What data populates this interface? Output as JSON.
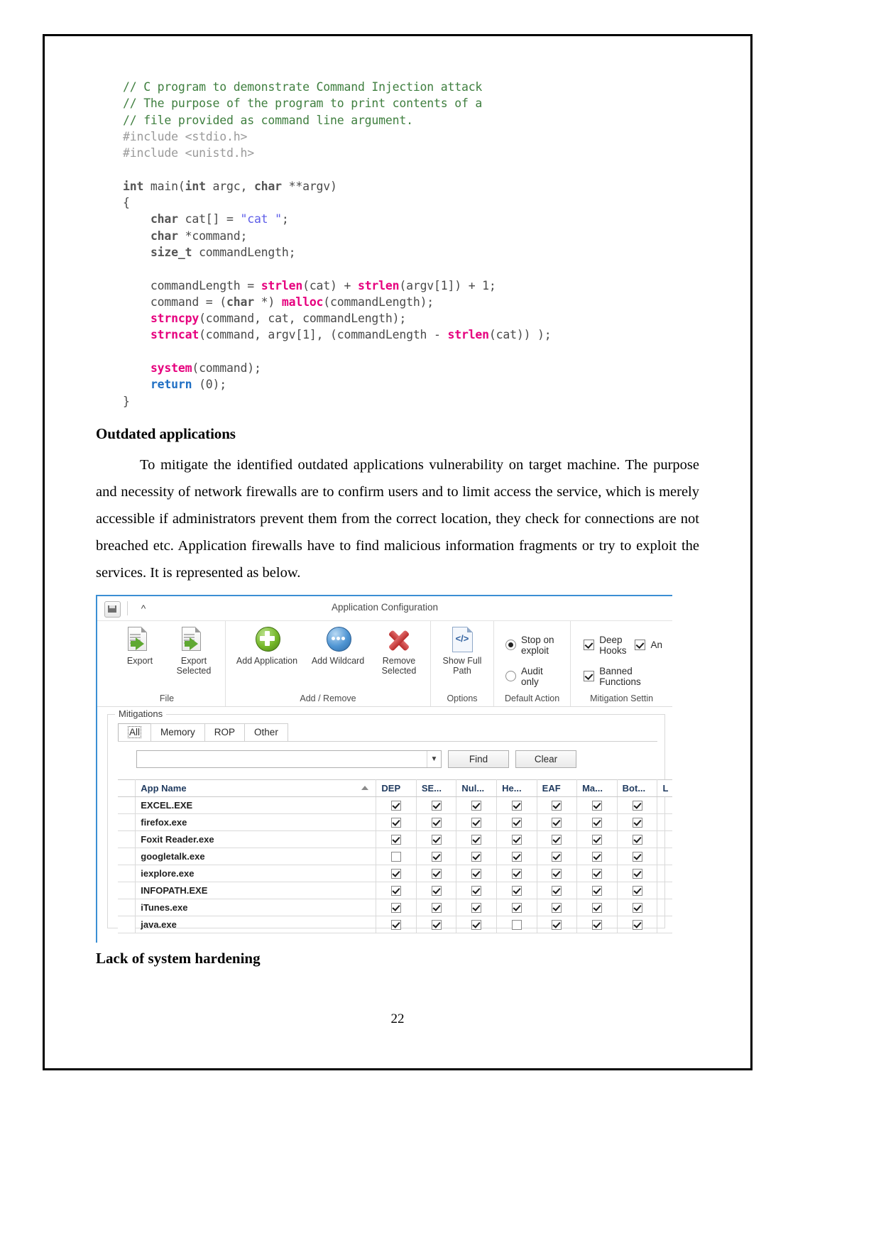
{
  "document": {
    "page_number": "22",
    "code": {
      "language": "c",
      "lines": [
        [
          {
            "t": "// C program to demonstrate Command Injection attack",
            "c": "comment"
          }
        ],
        [
          {
            "t": "// The purpose of the program to print contents of a",
            "c": "comment"
          }
        ],
        [
          {
            "t": "// file provided as command line argument.",
            "c": "comment"
          }
        ],
        [
          {
            "t": "#include <stdio.h>",
            "c": "pre"
          }
        ],
        [
          {
            "t": "#include <unistd.h>",
            "c": "pre"
          }
        ],
        [
          {
            "t": "",
            "c": "plain"
          }
        ],
        [
          {
            "t": "int",
            "c": "kw"
          },
          {
            "t": " main(",
            "c": "plain"
          },
          {
            "t": "int",
            "c": "kw"
          },
          {
            "t": " argc, ",
            "c": "plain"
          },
          {
            "t": "char",
            "c": "kw"
          },
          {
            "t": " **argv)",
            "c": "plain"
          }
        ],
        [
          {
            "t": "{",
            "c": "plain"
          }
        ],
        [
          {
            "t": "    ",
            "c": "plain"
          },
          {
            "t": "char",
            "c": "kw"
          },
          {
            "t": " cat[] = ",
            "c": "plain"
          },
          {
            "t": "\"cat \"",
            "c": "str"
          },
          {
            "t": ";",
            "c": "plain"
          }
        ],
        [
          {
            "t": "    ",
            "c": "plain"
          },
          {
            "t": "char",
            "c": "kw"
          },
          {
            "t": " *command;",
            "c": "plain"
          }
        ],
        [
          {
            "t": "    ",
            "c": "plain"
          },
          {
            "t": "size_t",
            "c": "kw"
          },
          {
            "t": " commandLength;",
            "c": "plain"
          }
        ],
        [
          {
            "t": "",
            "c": "plain"
          }
        ],
        [
          {
            "t": "    commandLength = ",
            "c": "plain"
          },
          {
            "t": "strlen",
            "c": "pink"
          },
          {
            "t": "(cat) + ",
            "c": "plain"
          },
          {
            "t": "strlen",
            "c": "pink"
          },
          {
            "t": "(argv[1]) + 1;",
            "c": "plain"
          }
        ],
        [
          {
            "t": "    command = (",
            "c": "plain"
          },
          {
            "t": "char",
            "c": "kw"
          },
          {
            "t": " *) ",
            "c": "plain"
          },
          {
            "t": "malloc",
            "c": "pink"
          },
          {
            "t": "(commandLength);",
            "c": "plain"
          }
        ],
        [
          {
            "t": "    ",
            "c": "plain"
          },
          {
            "t": "strncpy",
            "c": "pink"
          },
          {
            "t": "(command, cat, commandLength);",
            "c": "plain"
          }
        ],
        [
          {
            "t": "    ",
            "c": "plain"
          },
          {
            "t": "strncat",
            "c": "pink"
          },
          {
            "t": "(command, argv[1], (commandLength - ",
            "c": "plain"
          },
          {
            "t": "strlen",
            "c": "pink"
          },
          {
            "t": "(cat)) );",
            "c": "plain"
          }
        ],
        [
          {
            "t": "",
            "c": "plain"
          }
        ],
        [
          {
            "t": "    ",
            "c": "plain"
          },
          {
            "t": "system",
            "c": "pink"
          },
          {
            "t": "(command);",
            "c": "plain"
          }
        ],
        [
          {
            "t": "    ",
            "c": "plain"
          },
          {
            "t": "return",
            "c": "blue"
          },
          {
            "t": " (0);",
            "c": "plain"
          }
        ],
        [
          {
            "t": "}",
            "c": "plain"
          }
        ]
      ]
    },
    "heading_outdated": "Outdated applications",
    "paragraph": "To mitigate the identified outdated applications vulnerability on target machine. The purpose and necessity of network firewalls are to confirm users and to limit access the service, which is merely accessible if administrators prevent them from the correct location, they check for connections are not breached etc.  Application firewalls have to find malicious information fragments or try to exploit the services.  It is represented as below.",
    "heading_hardening": "Lack of system hardening"
  },
  "emet": {
    "title": "Application Configuration",
    "quick_access": {
      "save_icon": "save-icon",
      "chevron_icon": "chevron-up-icon"
    },
    "ribbon": {
      "groups": [
        {
          "label": "File",
          "buttons": [
            {
              "label": "Export",
              "icon": "export-page-icon"
            },
            {
              "label": "Export\nSelected",
              "icon": "export-selected-page-icon"
            }
          ]
        },
        {
          "label": "Add / Remove",
          "buttons": [
            {
              "label": "Add Application",
              "icon": "green-plus-circle-icon"
            },
            {
              "label": "Add Wildcard",
              "icon": "blue-ellipsis-circle-icon"
            },
            {
              "label": "Remove\nSelected",
              "icon": "red-x-icon"
            }
          ]
        },
        {
          "label": "Options",
          "buttons": [
            {
              "label": "Show Full\nPath",
              "icon": "code-page-icon"
            }
          ]
        },
        {
          "label": "Default Action",
          "radios": [
            {
              "label": "Stop on exploit",
              "checked": true,
              "accesskey": "S"
            },
            {
              "label": "Audit only",
              "checked": false,
              "accesskey": "u"
            }
          ]
        },
        {
          "label": "Mitigation Settin",
          "checkboxes": [
            {
              "label": "Deep Hooks",
              "checked": true,
              "accesskey": "H"
            },
            {
              "label": "An",
              "checked": true,
              "accesskey": ""
            },
            {
              "label": "Banned Functions",
              "checked": true,
              "accesskey": "B"
            }
          ]
        }
      ]
    },
    "mitigations": {
      "legend": "Mitigations",
      "tabs": [
        {
          "label": "All",
          "active": true
        },
        {
          "label": "Memory",
          "active": false
        },
        {
          "label": "ROP",
          "active": false
        },
        {
          "label": "Other",
          "active": false
        }
      ],
      "search": {
        "value": "",
        "placeholder": "",
        "dropdown_icon": "chevron-down-icon",
        "find_button": "Find",
        "clear_button": "Clear"
      },
      "table": {
        "columns": [
          "",
          "App Name",
          "DEP",
          "SE...",
          "Nul...",
          "He...",
          "EAF",
          "Ma...",
          "Bot...",
          "L"
        ],
        "sorted_by": "App Name",
        "sort_direction": "asc",
        "rows": [
          {
            "name": "EXCEL.EXE",
            "checks": [
              true,
              true,
              true,
              true,
              true,
              true,
              true
            ]
          },
          {
            "name": "firefox.exe",
            "checks": [
              true,
              true,
              true,
              true,
              true,
              true,
              true
            ]
          },
          {
            "name": "Foxit Reader.exe",
            "checks": [
              true,
              true,
              true,
              true,
              true,
              true,
              true
            ]
          },
          {
            "name": "googletalk.exe",
            "checks": [
              false,
              true,
              true,
              true,
              true,
              true,
              true
            ]
          },
          {
            "name": "iexplore.exe",
            "checks": [
              true,
              true,
              true,
              true,
              true,
              true,
              true
            ]
          },
          {
            "name": "INFOPATH.EXE",
            "checks": [
              true,
              true,
              true,
              true,
              true,
              true,
              true
            ]
          },
          {
            "name": "iTunes.exe",
            "checks": [
              true,
              true,
              true,
              true,
              true,
              true,
              true
            ]
          },
          {
            "name": "java.exe",
            "checks": [
              true,
              true,
              true,
              false,
              true,
              true,
              true
            ]
          }
        ]
      }
    }
  },
  "colors": {
    "code_comment": "#3f7f3f",
    "code_preprocessor": "#9a9a9a",
    "code_function": "#e6007e",
    "code_keyword": "#555555",
    "code_return": "#1f6fc4",
    "code_string": "#5d5de8",
    "window_accent": "#3b8fd4",
    "header_text": "#1f3a5f"
  }
}
